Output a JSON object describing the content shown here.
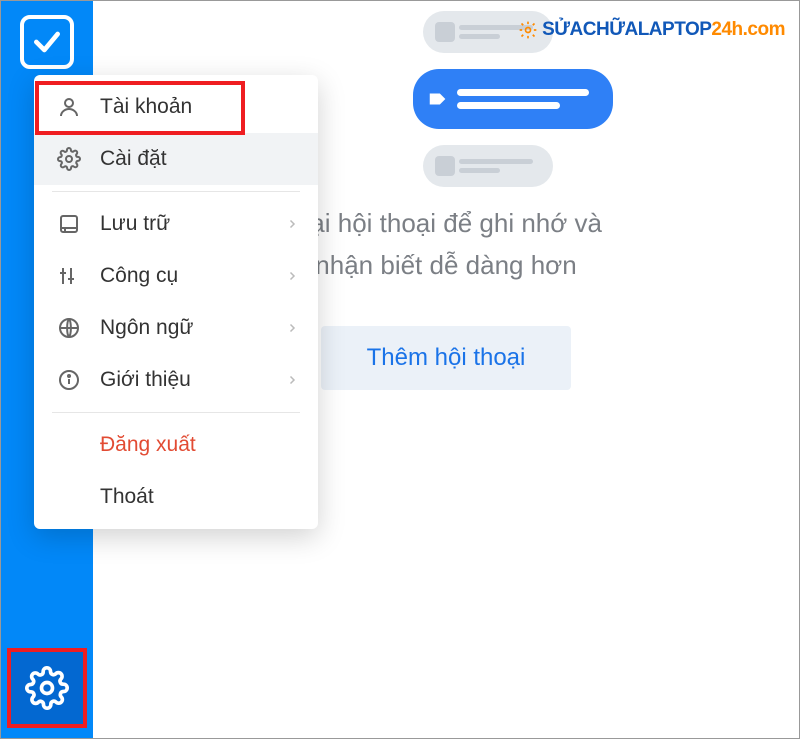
{
  "menu": {
    "account": "Tài khoản",
    "settings": "Cài đặt",
    "storage": "Lưu trữ",
    "tools": "Công cụ",
    "language": "Ngôn ngữ",
    "about": "Giới thiệu",
    "logout": "Đăng xuất",
    "exit": "Thoát"
  },
  "content": {
    "instruction_line1": "loại hội thoại để ghi nhớ và",
    "instruction_line2": "nhận biết dễ dàng hơn",
    "add_button": "Thêm hội thoại"
  },
  "watermark": {
    "part1": "SỬACHỮALAPTOP",
    "part2": "24h.com"
  }
}
